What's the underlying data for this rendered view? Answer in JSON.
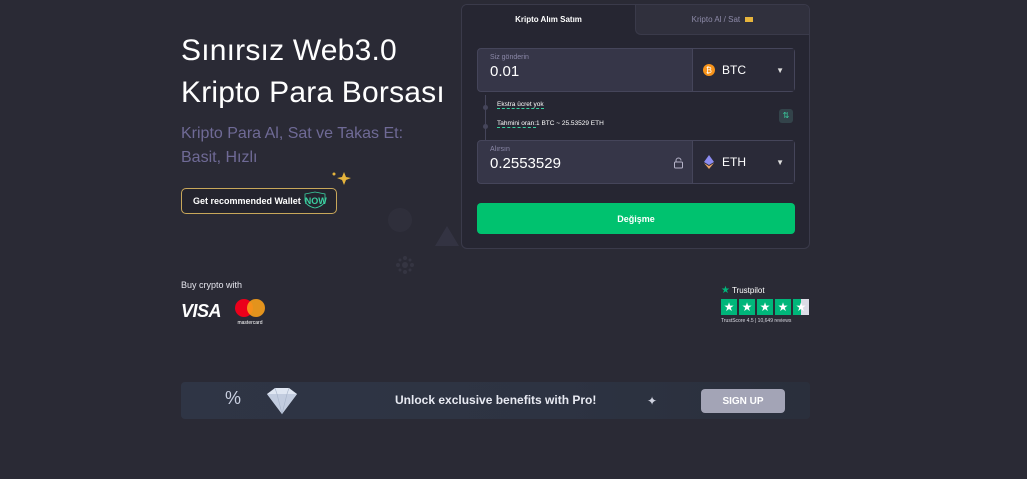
{
  "hero": {
    "title_line1": "Sınırsız Web3.0",
    "title_line2": "Kripto Para Borsası",
    "subtitle": "Kripto Para Al, Sat ve Takas Et: Basit, Hızlı",
    "wallet_button": "Get recommended Wallet",
    "wallet_badge": "NOW"
  },
  "payments": {
    "label": "Buy crypto with",
    "visa": "VISA",
    "mastercard": "mastercard"
  },
  "trustpilot": {
    "brand": "Trustpilot",
    "score_text": "TrustScore 4.5 | 10,649 reviews",
    "rating": 4.5
  },
  "exchange": {
    "tabs": [
      {
        "label": "Kripto Alım Satım",
        "active": true
      },
      {
        "label": "Kripto Al / Sat",
        "active": false
      }
    ],
    "send": {
      "label": "Siz gönderin",
      "value": "0.01",
      "coin": "BTC"
    },
    "fee_note": "Ekstra ücret yok",
    "rate_label": "Tahmini oran:",
    "rate_value": "1 BTC ~ 25.53529 ETH",
    "receive": {
      "label": "Alırsın",
      "value": "0.2553529",
      "coin": "ETH"
    },
    "submit": "Değişme"
  },
  "promo": {
    "percent_icon": "%",
    "text": "Unlock exclusive benefits with Pro!",
    "signup": "SIGN UP"
  },
  "colors": {
    "background": "#2a2a35",
    "accent_green": "#00c26f",
    "gold": "#c8a75a",
    "subtitle": "#6f6a96"
  }
}
